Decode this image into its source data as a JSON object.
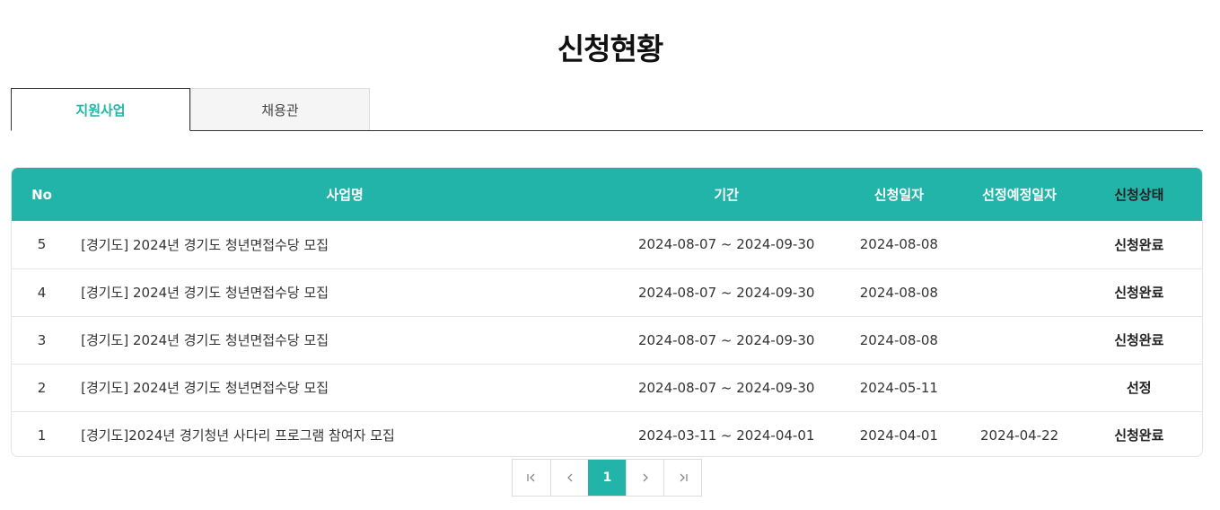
{
  "page": {
    "title": "신청현황"
  },
  "tabs": [
    {
      "label": "지원사업",
      "active": true
    },
    {
      "label": "채용관",
      "active": false
    }
  ],
  "table": {
    "headers": {
      "no": "No",
      "name": "사업명",
      "period": "기간",
      "apply_date": "신청일자",
      "selection_date": "선정예정일자",
      "status": "신청상태"
    },
    "rows": [
      {
        "no": "5",
        "name": "[경기도] 2024년 경기도 청년면접수당 모집",
        "period": "2024-08-07 ~ 2024-09-30",
        "apply_date": "2024-08-08",
        "selection_date": "",
        "status": "신청완료"
      },
      {
        "no": "4",
        "name": "[경기도] 2024년 경기도 청년면접수당 모집",
        "period": "2024-08-07 ~ 2024-09-30",
        "apply_date": "2024-08-08",
        "selection_date": "",
        "status": "신청완료"
      },
      {
        "no": "3",
        "name": "[경기도] 2024년 경기도 청년면접수당 모집",
        "period": "2024-08-07 ~ 2024-09-30",
        "apply_date": "2024-08-08",
        "selection_date": "",
        "status": "신청완료"
      },
      {
        "no": "2",
        "name": "[경기도] 2024년 경기도 청년면접수당 모집",
        "period": "2024-08-07 ~ 2024-09-30",
        "apply_date": "2024-05-11",
        "selection_date": "",
        "status": "선정"
      },
      {
        "no": "1",
        "name": "[경기도]2024년 경기청년 사다리 프로그램 참여자 모집",
        "period": "2024-03-11 ~ 2024-04-01",
        "apply_date": "2024-04-01",
        "selection_date": "2024-04-22",
        "status": "신청완료"
      }
    ]
  },
  "pagination": {
    "current_page": "1",
    "icons": {
      "first": "first-page-icon",
      "prev": "prev-page-icon",
      "next": "next-page-icon",
      "last": "last-page-icon"
    }
  },
  "colors": {
    "accent": "#22b4a8",
    "header_text": "#ffffff",
    "border": "#dddddd"
  }
}
